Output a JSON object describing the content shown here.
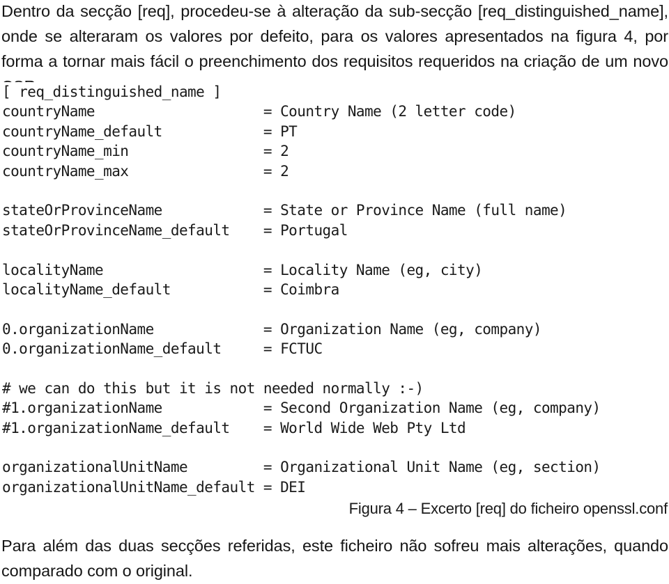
{
  "document": {
    "language": "pt",
    "intro_paragraph": "Dentro da secção [req], procedeu-se à alteração da sub-secção [req_distinguished_name], onde se alteraram os valores por defeito, para os valores apresentados na figura 4, por forma a tornar mais fácil o preenchimento dos requisitos  requeridos na criação de um novo CSR.",
    "closing_paragraph": "Para além das duas secções referidas, este ficheiro não sofreu mais alterações, quando comparado com o original.",
    "figure_caption": "Figura 4 – Excerto [req] do ficheiro openssl.conf"
  },
  "code_excerpt": {
    "section_header": "[ req_distinguished_name ]",
    "lines": [
      "[ req_distinguished_name ]",
      "countryName                    = Country Name (2 letter code)",
      "countryName_default            = PT",
      "countryName_min                = 2",
      "countryName_max                = 2",
      "",
      "stateOrProvinceName            = State or Province Name (full name)",
      "stateOrProvinceName_default    = Portugal",
      "",
      "localityName                   = Locality Name (eg, city)",
      "localityName_default           = Coimbra",
      "",
      "0.organizationName             = Organization Name (eg, company)",
      "0.organizationName_default     = FCTUC",
      "",
      "# we can do this but it is not needed normally :-)",
      "#1.organizationName            = Second Organization Name (eg, company)",
      "#1.organizationName_default    = World Wide Web Pty Ltd",
      "",
      "organizationalUnitName         = Organizational Unit Name (eg, section)",
      "organizationalUnitName_default = DEI"
    ],
    "entries": [
      {
        "key": "countryName",
        "value": "Country Name (2 letter code)"
      },
      {
        "key": "countryName_default",
        "value": "PT"
      },
      {
        "key": "countryName_min",
        "value": "2"
      },
      {
        "key": "countryName_max",
        "value": "2"
      },
      {
        "key": "stateOrProvinceName",
        "value": "State or Province Name (full name)"
      },
      {
        "key": "stateOrProvinceName_default",
        "value": "Portugal"
      },
      {
        "key": "localityName",
        "value": "Locality Name (eg, city)"
      },
      {
        "key": "localityName_default",
        "value": "Coimbra"
      },
      {
        "key": "0.organizationName",
        "value": "Organization Name (eg, company)"
      },
      {
        "key": "0.organizationName_default",
        "value": "FCTUC"
      },
      {
        "key": "#1.organizationName",
        "value": "Second Organization Name (eg, company)"
      },
      {
        "key": "#1.organizationName_default",
        "value": "World Wide Web Pty Ltd"
      },
      {
        "key": "organizationalUnitName",
        "value": "Organizational Unit Name (eg, section)"
      },
      {
        "key": "organizationalUnitName_default",
        "value": "DEI"
      }
    ],
    "comment": "# we can do this but it is not needed normally :-)"
  },
  "colors": {
    "page_background": "#ffffff",
    "body_text": "#161616",
    "code_text": "#1a1a1a"
  }
}
